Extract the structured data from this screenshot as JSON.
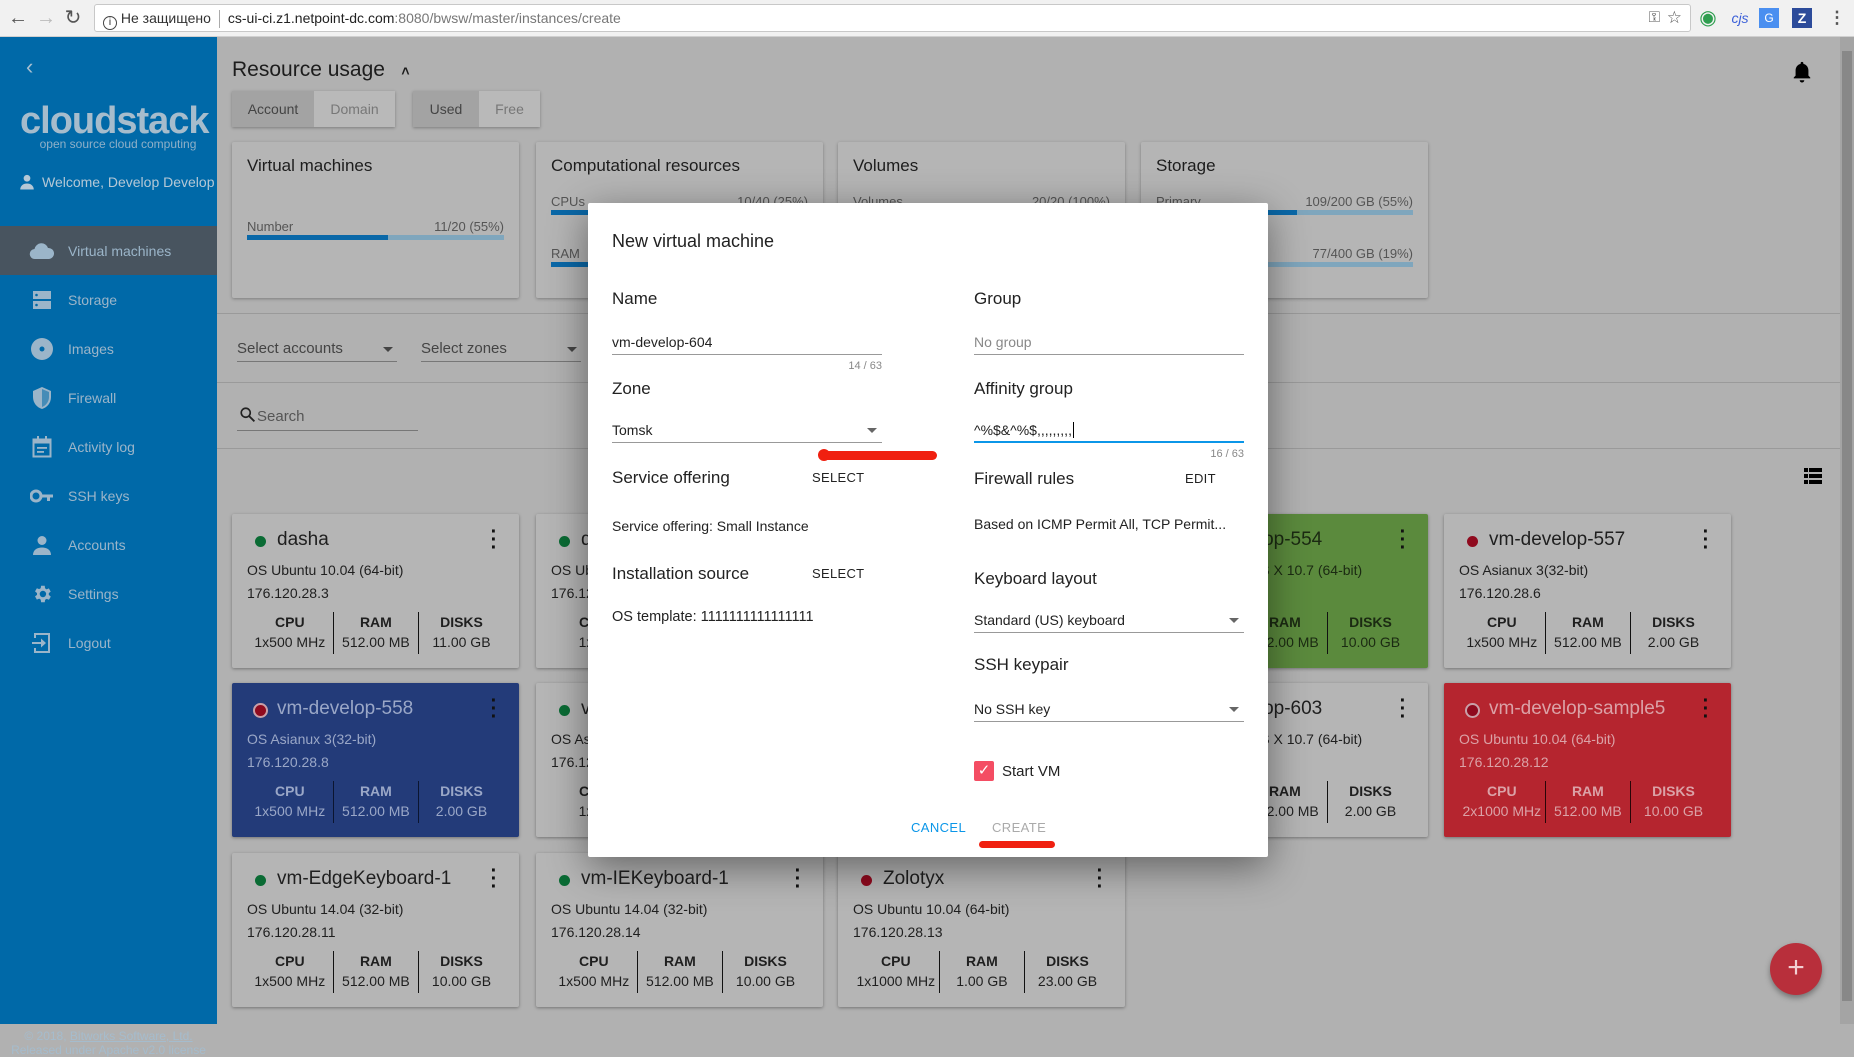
{
  "browser": {
    "security_label": "Не защищено",
    "url_host": "cs-ui-ci.z1.netpoint-dc.com",
    "url_path": ":8080/bwsw/master/instances/create",
    "ext_cjs": "cjs",
    "ext_z": "Z"
  },
  "sidebar": {
    "logo": "cloudstack",
    "logo_tagline": "open source cloud computing",
    "welcome": "Welcome, Develop Develop",
    "items": [
      {
        "label": "Virtual machines",
        "icon": "cloud-icon",
        "active": true
      },
      {
        "label": "Storage",
        "icon": "storage-icon"
      },
      {
        "label": "Images",
        "icon": "disc-icon"
      },
      {
        "label": "Firewall",
        "icon": "shield-icon"
      },
      {
        "label": "Activity log",
        "icon": "calendar-icon"
      },
      {
        "label": "SSH keys",
        "icon": "key-icon"
      },
      {
        "label": "Accounts",
        "icon": "person-icon"
      },
      {
        "label": "Settings",
        "icon": "gear-icon"
      },
      {
        "label": "Logout",
        "icon": "logout-icon"
      }
    ],
    "footer_prefix": "© 2018, ",
    "footer_link": "Bitworks Software, Ltd.",
    "footer_line2": "Released under Apache v2.0 license"
  },
  "resource_usage": {
    "title": "Resource usage",
    "scope_toggle": [
      "Account",
      "Domain"
    ],
    "scope_selected": "Account",
    "mode_toggle": [
      "Used",
      "Free"
    ],
    "mode_selected": "Used",
    "cards": [
      {
        "title": "Virtual machines",
        "rows": [
          {
            "label": "Number",
            "value": "11/20 (55%)",
            "percent": 55
          }
        ]
      },
      {
        "title": "Computational resources",
        "rows": [
          {
            "label": "CPUs",
            "value": "10/40 (25%)",
            "percent": 25
          },
          {
            "label": "RAM",
            "value": "",
            "percent": 25
          }
        ]
      },
      {
        "title": "Volumes",
        "rows": [
          {
            "label": "Volumes",
            "value": "20/20 (100%)",
            "percent": 100
          },
          {
            "label": "",
            "value": "",
            "percent": 50
          }
        ]
      },
      {
        "title": "Storage",
        "rows": [
          {
            "label": "Primary",
            "value": "109/200 GB (55%)",
            "percent": 55
          },
          {
            "label": "",
            "value": "77/400 GB (19%)",
            "percent": 19
          }
        ]
      }
    ]
  },
  "filters": {
    "accounts_placeholder": "Select accounts",
    "zones_placeholder": "Select zones",
    "search_placeholder": "Search"
  },
  "stat_headers": {
    "cpu": "CPU",
    "ram": "RAM",
    "disks": "DISKS"
  },
  "status_colors": {
    "running": "#0a6b34",
    "stopped": "#8f0a1e"
  },
  "vm_rows": [
    [
      {
        "name": "dasha",
        "status": "running",
        "os": "OS Ubuntu 10.04 (64-bit)",
        "ip": "176.120.28.3",
        "cpu": "1x500 MHz",
        "ram": "512.00 MB",
        "disks": "11.00 GB",
        "theme": "default"
      },
      {
        "name": "d",
        "status": "running",
        "os": "OS Ub",
        "ip": "176.12",
        "cpu": "1x50",
        "ram": "",
        "disks": "",
        "theme": "default"
      },
      null,
      {
        "name": "vm-develop-554",
        "status": "running",
        "os": "OS Apple Mac OS X 10.7 (64-bit)",
        "ip": "",
        "cpu": "",
        "ram": "512.00 MB",
        "disks": "10.00 GB",
        "theme": "green"
      },
      {
        "name": "vm-develop-557",
        "status": "stopped",
        "os": "OS Asianux 3(32-bit)",
        "ip": "176.120.28.6",
        "cpu": "1x500 MHz",
        "ram": "512.00 MB",
        "disks": "2.00 GB",
        "theme": "default"
      }
    ],
    [
      {
        "name": "vm-develop-558",
        "status": "stopped",
        "os": "OS Asianux 3(32-bit)",
        "ip": "176.120.28.8",
        "cpu": "1x500 MHz",
        "ram": "512.00 MB",
        "disks": "2.00 GB",
        "theme": "blue"
      },
      {
        "name": "v",
        "status": "running",
        "os": "OS As",
        "ip": "176.12",
        "cpu": "1x50",
        "ram": "",
        "disks": "",
        "theme": "default"
      },
      null,
      {
        "name": "vm-develop-603",
        "status": "running",
        "os": "OS Apple Mac OS X 10.7 (64-bit)",
        "ip": "",
        "cpu": "",
        "ram": "512.00 MB",
        "disks": "2.00 GB",
        "theme": "default"
      },
      {
        "name": "vm-develop-sample5",
        "status": "stopped",
        "os": "OS Ubuntu 10.04 (64-bit)",
        "ip": "176.120.28.12",
        "cpu": "2x1000 MHz",
        "ram": "512.00 MB",
        "disks": "10.00 GB",
        "theme": "red"
      }
    ],
    [
      {
        "name": "vm-EdgeKeyboard-1",
        "status": "running",
        "os": "OS Ubuntu 14.04 (32-bit)",
        "ip": "176.120.28.11",
        "cpu": "1x500 MHz",
        "ram": "512.00 MB",
        "disks": "10.00 GB",
        "theme": "default"
      },
      {
        "name": "vm-IEKeyboard-1",
        "status": "running",
        "os": "OS Ubuntu 14.04 (32-bit)",
        "ip": "176.120.28.14",
        "cpu": "1x500 MHz",
        "ram": "512.00 MB",
        "disks": "10.00 GB",
        "theme": "default"
      },
      {
        "name": "Zolotyx",
        "status": "stopped",
        "os": "OS Ubuntu 10.04 (64-bit)",
        "ip": "176.120.28.13",
        "cpu": "1x1000 MHz",
        "ram": "1.00 GB",
        "disks": "23.00 GB",
        "theme": "default"
      }
    ]
  ],
  "fab_label": "+",
  "dialog": {
    "title": "New virtual machine",
    "name_label": "Name",
    "name_value": "vm-develop-604",
    "name_counter": "14 / 63",
    "zone_label": "Zone",
    "zone_value": "Tomsk",
    "service_label": "Service offering",
    "service_button": "SELECT",
    "service_value": "Service offering: Small Instance",
    "install_label": "Installation source",
    "install_button": "SELECT",
    "install_value": "OS template: 1111111111111111",
    "group_label": "Group",
    "group_placeholder": "No group",
    "affinity_label": "Affinity group",
    "affinity_value": "^%$&^%$,,,,,,,,,",
    "affinity_counter": "16 / 63",
    "firewall_label": "Firewall rules",
    "firewall_button": "EDIT",
    "firewall_value": "Based on ICMP Permit All, TCP Permit...",
    "keyboard_label": "Keyboard layout",
    "keyboard_value": "Standard (US) keyboard",
    "ssh_label": "SSH keypair",
    "ssh_value": "No SSH key",
    "start_vm_label": "Start VM",
    "start_vm_checked": true,
    "cancel": "CANCEL",
    "create": "CREATE",
    "create_disabled": true,
    "accent_color": "#0b96e8",
    "checkbox_color": "#f44d63"
  }
}
